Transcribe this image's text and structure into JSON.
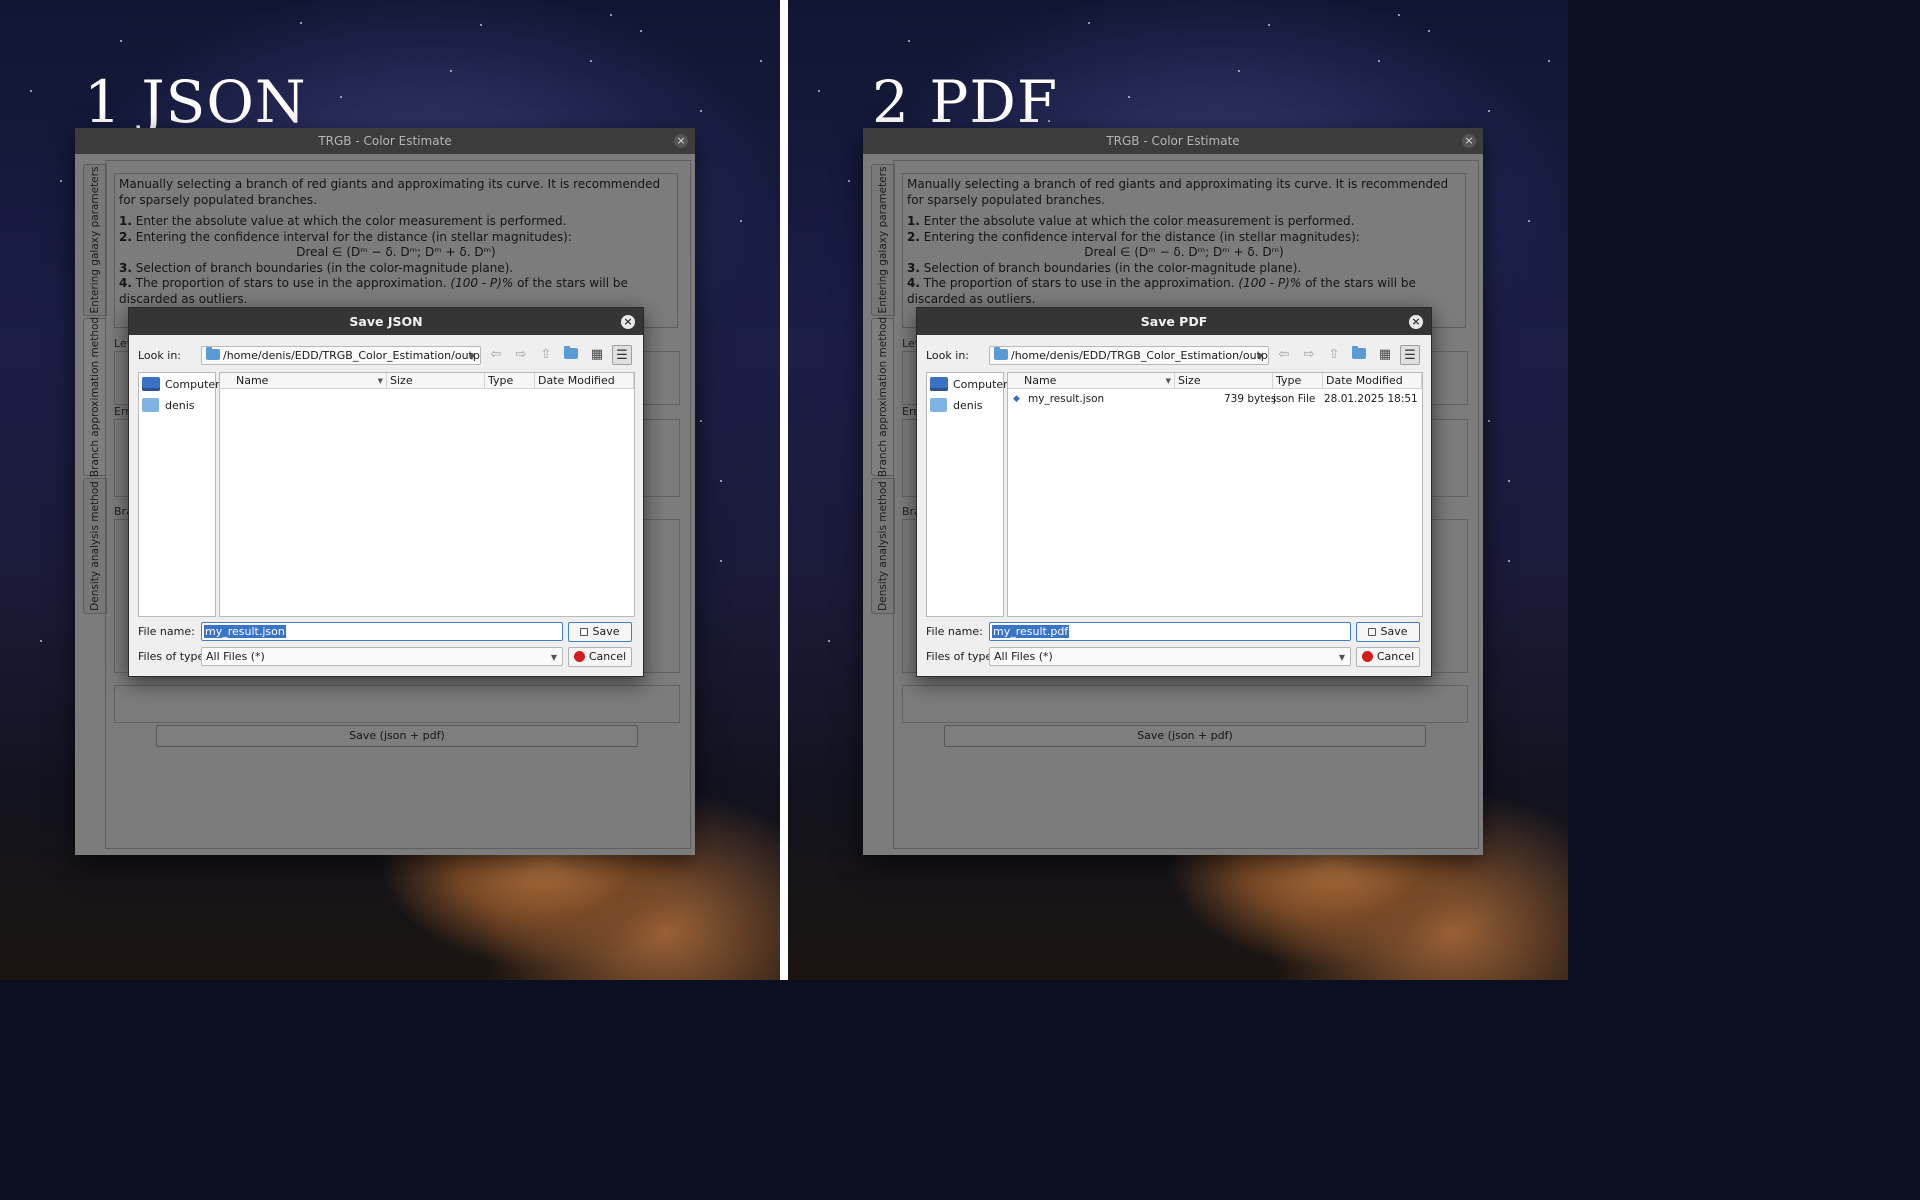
{
  "panels": [
    {
      "big_label": "1 JSON",
      "window_title": "TRGB - Color Estimate",
      "dialog_title": "Save JSON",
      "file_name": "my_result.json",
      "has_file": false
    },
    {
      "big_label": "2 PDF",
      "window_title": "TRGB - Color Estimate",
      "dialog_title": "Save PDF",
      "file_name": "my_result.pdf",
      "has_file": true
    }
  ],
  "tabs": [
    "Entering galaxy parameters",
    "Branch approximation method",
    "Density analysis method"
  ],
  "description": {
    "intro": "Manually selecting a branch of red giants and approximating its curve. It is recommended for sparsely populated branches.",
    "step1_num": "1.",
    "step1": " Enter the absolute value at which the color measurement is performed.",
    "step2_num": "2.",
    "step2": " Entering the confidence interval for the distance (in stellar magnitudes):",
    "formula": "Dreal ∈ (Dᵐ − δ. Dᵐ; Dᵐ + δ. Dᵐ)",
    "step3_num": "3.",
    "step3": " Selection of branch boundaries (in the color-magnitude plane).",
    "step4_num": "4.",
    "step4": " The proportion of stars to use in the approximation. ",
    "step4_ital": "(100 - P)%",
    "step4_tail": " of the stars will be discarded as outliers."
  },
  "side_labels": {
    "lev": "Lev",
    "err": "Erro",
    "bra": "Bra"
  },
  "save_both_button": "Save (json + pdf)",
  "dialog": {
    "look_in_label": "Look in:",
    "look_in_path": "/home/denis/EDD/TRGB_Color_Estimation/output",
    "sidebar": [
      "Computer",
      "denis"
    ],
    "columns": [
      "Name",
      "Size",
      "Type",
      "Date Modified"
    ],
    "file": {
      "name": "my_result.json",
      "size": "739 bytes",
      "type": "json File",
      "date": "28.01.2025 18:51"
    },
    "file_name_label": "File name:",
    "files_of_type_label": "Files of type:",
    "files_of_type_value": "All Files (*)",
    "save_button": "Save",
    "cancel_button": "Cancel"
  },
  "icons": [
    "back-arrow-icon",
    "forward-arrow-icon",
    "up-arrow-icon",
    "new-folder-icon",
    "list-view-icon",
    "detail-view-icon",
    "computer-icon",
    "home-folder-icon",
    "json-file-icon",
    "save-icon",
    "cancel-icon"
  ],
  "colors": {
    "dialog_title_bar": "#353535",
    "selection": "#3874c8",
    "main_window_dimmed": "#7c7c7c"
  }
}
